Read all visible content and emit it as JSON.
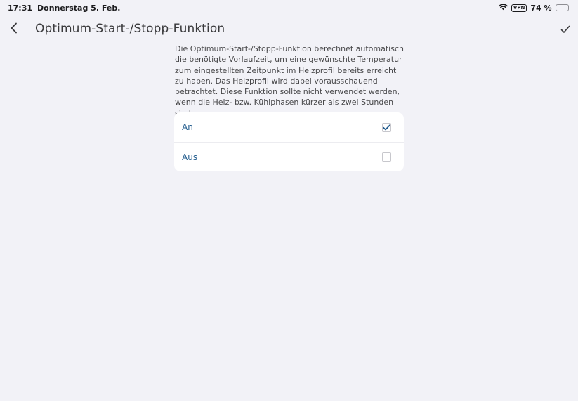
{
  "status_bar": {
    "time": "17:31",
    "date": "Donnerstag 5. Feb.",
    "vpn": "VPN",
    "battery_text": "74 %",
    "battery_level": 0.74,
    "icons": {
      "wifi": "wifi-icon",
      "battery": "battery-icon"
    }
  },
  "header": {
    "title": "Optimum-Start-/Stopp-Funktion",
    "back_icon": "chevron-left-icon",
    "confirm_icon": "checkmark-icon"
  },
  "description": "Die Optimum-Start-/Stopp-Funktion berechnet automatisch die benötigte Vorlaufzeit, um eine gewünschte Temperatur zum eingestellten Zeitpunkt im Heizprofil bereits erreicht zu haben. Das Heizprofil wird dabei vorausschauend betrachtet. Diese Funktion sollte nicht verwendet werden, wenn die Heiz- bzw. Kühlphasen kürzer als zwei Stunden sind.",
  "options": [
    {
      "label": "An",
      "checked": true
    },
    {
      "label": "Aus",
      "checked": false
    }
  ],
  "colors": {
    "accent": "#1f5a8c",
    "background": "#f2f2f7",
    "card": "#ffffff"
  }
}
